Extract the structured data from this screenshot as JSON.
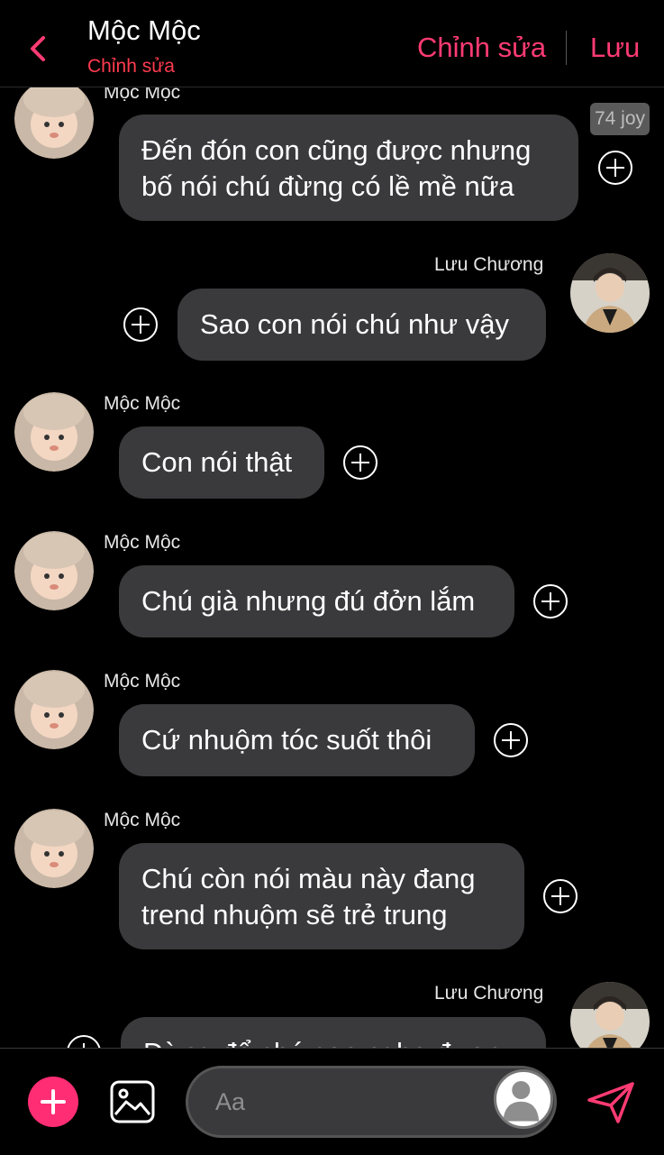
{
  "header": {
    "title": "Mộc Mộc",
    "subtitle": "Chỉnh sửa",
    "edit_label": "Chỉnh sửa",
    "save_label": "Lưu"
  },
  "reaction_badge": "74 joy",
  "messages": [
    {
      "sender": "Mộc Mộc",
      "text": "Đến đón con cũng được nhưng\nbố nói chú đừng có lề mề nữa",
      "side": "left"
    },
    {
      "sender": "Lưu Chương",
      "text": "Sao con nói chú như vậy",
      "side": "right"
    },
    {
      "sender": "Mộc Mộc",
      "text": "Con nói thật",
      "side": "left"
    },
    {
      "sender": "Mộc Mộc",
      "text": "Chú già nhưng đú đởn lắm",
      "side": "left"
    },
    {
      "sender": "Mộc Mộc",
      "text": "Cứ nhuộm tóc suốt thôi",
      "side": "left"
    },
    {
      "sender": "Mộc Mộc",
      "text": "Chú còn nói màu này đang\ntrend nhuộm sẽ trẻ trung",
      "side": "left"
    },
    {
      "sender": "Lưu Chương",
      "text": "Đừng để chú con nghe được",
      "side": "right"
    }
  ],
  "composer": {
    "placeholder": "Aa"
  },
  "colors": {
    "accent": "#ff3b73",
    "subtitle": "#ff3b4e",
    "bubble": "#3a3a3c",
    "background": "#000000"
  }
}
